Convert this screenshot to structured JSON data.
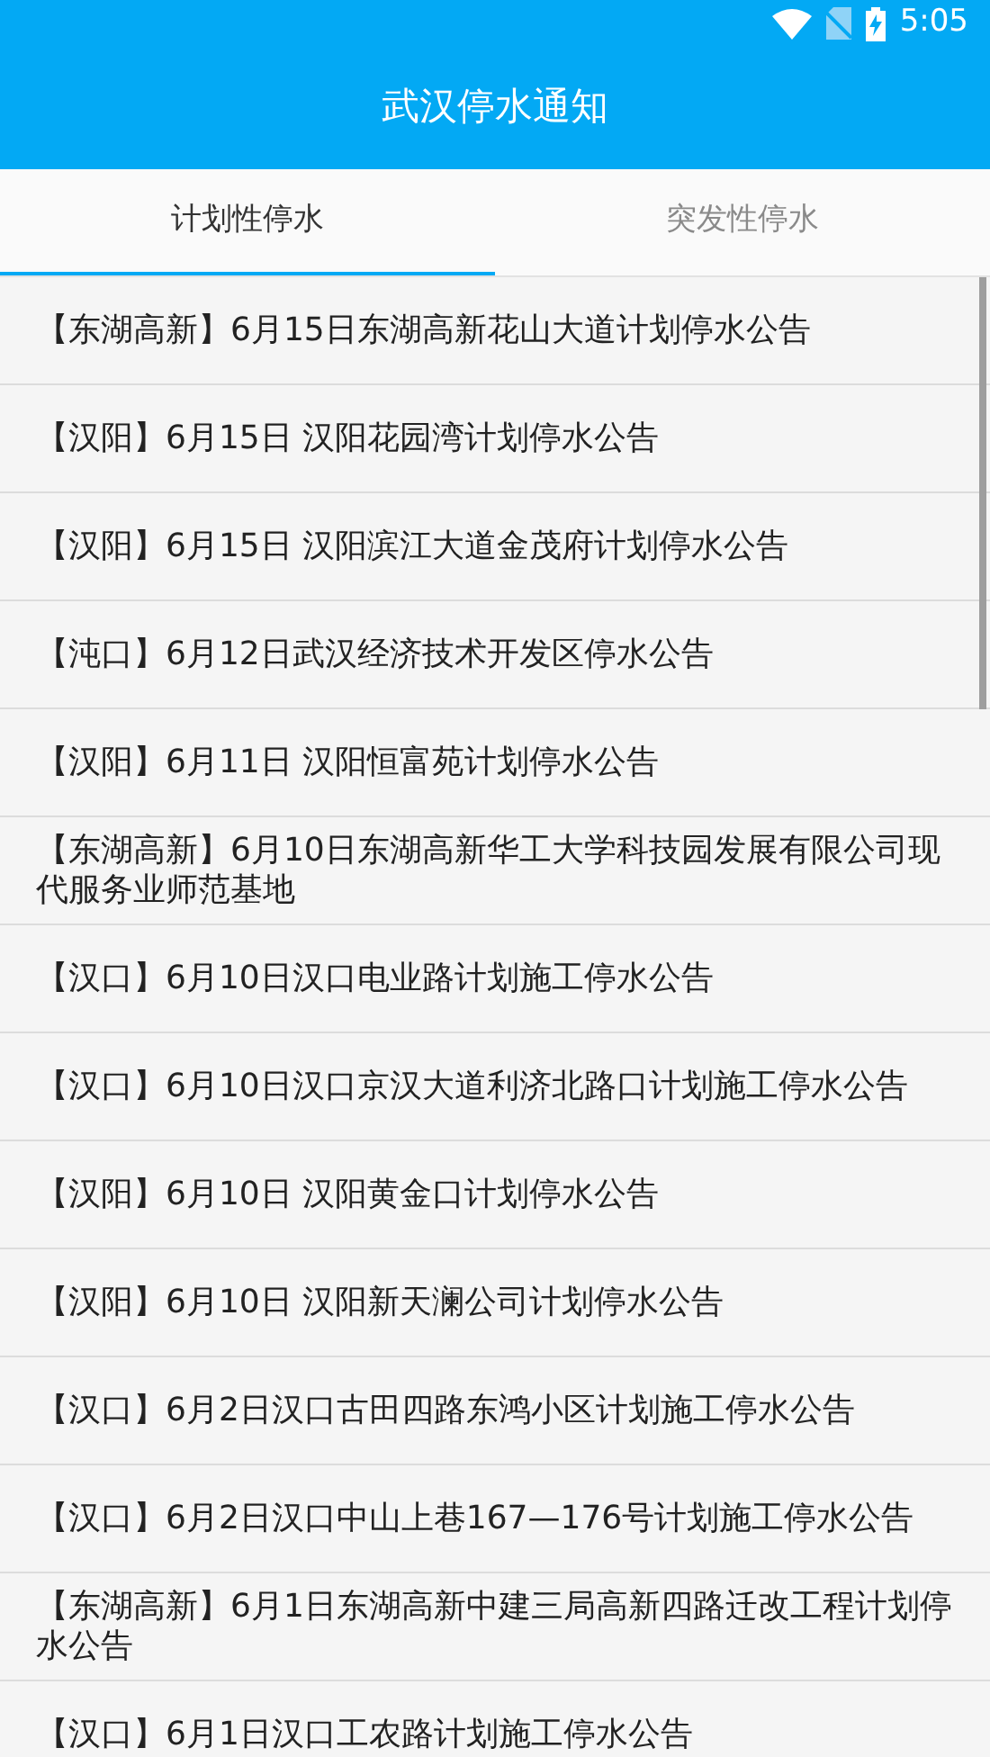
{
  "status_bar": {
    "time": "5:05"
  },
  "app_bar": {
    "title": "武汉停水通知"
  },
  "tabs": [
    {
      "label": "计划性停水",
      "selected": true
    },
    {
      "label": "突发性停水",
      "selected": false
    }
  ],
  "notices": [
    {
      "text": "【东湖高新】6月15日东湖高新花山大道计划停水公告"
    },
    {
      "text": "【汉阳】6月15日 汉阳花园湾计划停水公告"
    },
    {
      "text": "【汉阳】6月15日 汉阳滨江大道金茂府计划停水公告"
    },
    {
      "text": "【沌口】6月12日武汉经济技术开发区停水公告"
    },
    {
      "text": "【汉阳】6月11日 汉阳恒富苑计划停水公告"
    },
    {
      "text": "【东湖高新】6月10日东湖高新华工大学科技园发展有限公司现代服务业师范基地"
    },
    {
      "text": "【汉口】6月10日汉口电业路计划施工停水公告"
    },
    {
      "text": "【汉口】6月10日汉口京汉大道利济北路口计划施工停水公告"
    },
    {
      "text": "【汉阳】6月10日 汉阳黄金口计划停水公告"
    },
    {
      "text": "【汉阳】6月10日 汉阳新天澜公司计划停水公告"
    },
    {
      "text": "【汉口】6月2日汉口古田四路东鸿小区计划施工停水公告"
    },
    {
      "text": "【汉口】6月2日汉口中山上巷167—176号计划施工停水公告"
    },
    {
      "text": "【东湖高新】6月1日东湖高新中建三局高新四路迁改工程计划停水公告"
    },
    {
      "text": "【汉口】6月1日汉口工农路计划施工停水公告"
    }
  ]
}
